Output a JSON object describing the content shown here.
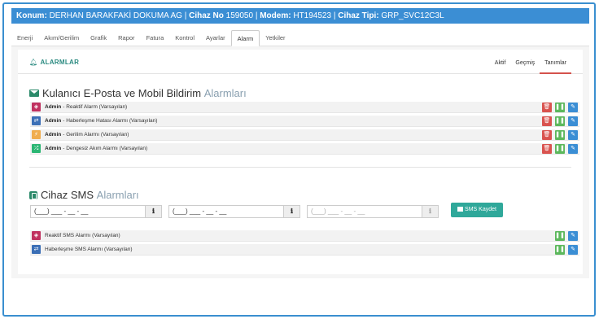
{
  "topbar": {
    "konum_label": "Konum:",
    "konum_value": "DERHAN BARAKFAKİ DOKUMA AG",
    "sep1": "|",
    "cihaz_no_label": "Cihaz No",
    "cihaz_no_value": "159050",
    "sep2": "|",
    "modem_label": "Modem:",
    "modem_value": "HT194523",
    "sep3": "|",
    "cihaz_tipi_label": "Cihaz Tipi:",
    "cihaz_tipi_value": "GRP_SVC12C3L"
  },
  "tabs": [
    "Enerji",
    "Akım/Gerilim",
    "Grafik",
    "Rapor",
    "Fatura",
    "Kontrol",
    "Ayarlar",
    "Alarm",
    "Yetkiler"
  ],
  "active_tab": "Alarm",
  "card": {
    "title": "ALARMLAR",
    "subtabs": [
      "Aktif",
      "Geçmiş",
      "Tanımlar"
    ],
    "active_subtab": "Tanımlar"
  },
  "email_section": {
    "title_main": "Kulanıcı E-Posta ve Mobil Bildirim",
    "title_muted": "Alarmları",
    "rows": [
      {
        "who": "Admin",
        "text": " - Reaktif Alarm (Varsayılan)",
        "icon": "reactive-icon",
        "color": "#c0315f"
      },
      {
        "who": "Admin",
        "text": " - Haberleşme Hatası Alarmı (Varsayılan)",
        "icon": "usb-icon",
        "color": "#3b6fb6"
      },
      {
        "who": "Admin",
        "text": " - Gerilim Alarmı (Varsayılan)",
        "icon": "bolt-icon",
        "color": "#f0ad4e"
      },
      {
        "who": "Admin",
        "text": " - Dengesiz Akım Alarmı (Varsayılan)",
        "icon": "shuffle-icon",
        "color": "#2bb673"
      }
    ]
  },
  "sms_section": {
    "title_main": "Cihaz SMS",
    "title_muted": "Alarmları",
    "inputs": [
      {
        "placeholder": "(___) ___ - __ - __"
      },
      {
        "placeholder": "(___) ___ - __ - __"
      },
      {
        "placeholder": "(___) ___ - __ - __"
      }
    ],
    "save_label": "SMS Kaydet",
    "rows": [
      {
        "text": "Reaktif SMS Alarmı (Varsayılan)",
        "icon": "reactive-icon",
        "color": "#c0315f"
      },
      {
        "text": "Haberleşme SMS Alarmı (Varsayılan)",
        "icon": "usb-icon",
        "color": "#3b6fb6"
      }
    ]
  },
  "colors": {
    "primary": "#3b8ed4",
    "teal": "#2fa89a",
    "danger": "#d9534f",
    "success": "#5cb85c"
  }
}
